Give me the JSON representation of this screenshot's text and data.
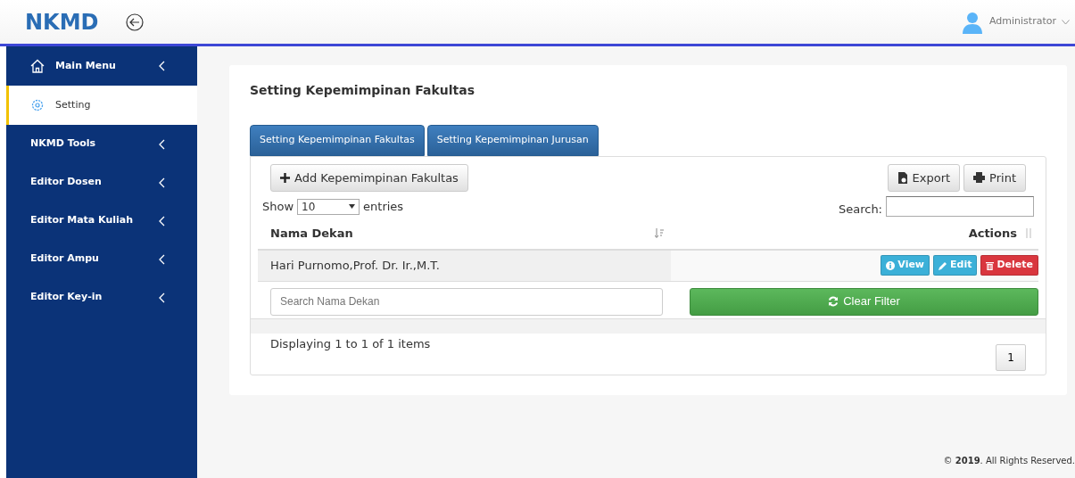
{
  "header": {
    "logo": "NKMD",
    "user": "Administrator"
  },
  "sidebar": {
    "items": [
      {
        "label": "Main Menu",
        "selected": false,
        "kind": "home"
      },
      {
        "label": "Setting",
        "selected": true,
        "kind": "gear"
      },
      {
        "label": "NKMD Tools",
        "selected": false,
        "kind": "plain"
      },
      {
        "label": "Editor Dosen",
        "selected": false,
        "kind": "plain"
      },
      {
        "label": "Editor Mata Kuliah",
        "selected": false,
        "kind": "plain"
      },
      {
        "label": "Editor Ampu",
        "selected": false,
        "kind": "plain"
      },
      {
        "label": "Editor Key-in",
        "selected": false,
        "kind": "plain"
      }
    ]
  },
  "page_title": "Setting Kepemimpinan Fakultas",
  "tabs": [
    {
      "label": "Setting Kepemimpinan Fakultas"
    },
    {
      "label": "Setting Kepemimpinan Jurusan"
    }
  ],
  "toolbar": {
    "add_button": "Add Kepemimpinan Fakultas",
    "export_button": "Export",
    "print_button": "Print"
  },
  "length": {
    "show": "Show",
    "value": "10",
    "entries": "entries"
  },
  "search": {
    "label": "Search:"
  },
  "table": {
    "columns": [
      {
        "label": "Nama Dekan"
      },
      {
        "label": "Actions"
      }
    ],
    "rows": [
      {
        "name": "Hari Purnomo,Prof. Dr. Ir.,M.T.",
        "actions": [
          {
            "label": "View",
            "kind": "info"
          },
          {
            "label": "Edit",
            "kind": "edit"
          },
          {
            "label": "Delete",
            "kind": "delete"
          }
        ]
      }
    ],
    "filter": {
      "placeholder": "Search Nama Dekan",
      "clear_button": "Clear Filter"
    }
  },
  "info": "Displaying 1 to 1 of 1 items",
  "pagination": [
    {
      "label": "1"
    }
  ],
  "footer": "© **2019**. All Rights Reserved."
}
